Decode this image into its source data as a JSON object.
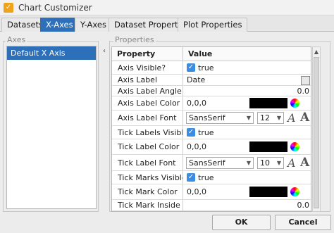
{
  "window": {
    "title": "Chart Customizer",
    "icon": "check-logo"
  },
  "tabs": [
    "Datasets",
    "X-Axes",
    "Y-Axes",
    "Dataset Properties",
    "Plot Properties"
  ],
  "axes_panel": {
    "legend": "Axes",
    "items": [
      "Default X Axis"
    ]
  },
  "properties_panel": {
    "legend": "Properties",
    "columns": {
      "property": "Property",
      "value": "Value"
    },
    "rows": [
      {
        "name": "Axis Visible?",
        "value": "true"
      },
      {
        "name": "Axis Label",
        "value": "Date"
      },
      {
        "name": "Axis Label Angle",
        "value": "0.0"
      },
      {
        "name": "Axis Label Color",
        "value": "0,0,0"
      },
      {
        "name": "Axis Label Font",
        "font": "SansSerif",
        "size": "12"
      },
      {
        "name": "Tick Labels Visible?",
        "value": "true"
      },
      {
        "name": "Tick Label Color",
        "value": "0,0,0"
      },
      {
        "name": "Tick Label Font",
        "font": "SansSerif",
        "size": "10"
      },
      {
        "name": "Tick Marks Visible?",
        "value": "true"
      },
      {
        "name": "Tick Mark Color",
        "value": "0,0,0"
      },
      {
        "name": "Tick Mark Inside L...",
        "value": "0.0"
      }
    ]
  },
  "buttons": {
    "ok": "OK",
    "cancel": "Cancel"
  },
  "colors": {
    "accent": "#2d6fb8",
    "checkbox": "#3a8de0",
    "swatch": "#000000",
    "app_icon": "#f0a21b"
  },
  "glyphs": {
    "check": "✓",
    "font_a": "A",
    "dropdown": "▼",
    "collapse": "‹",
    "scroll_up": "▲"
  }
}
